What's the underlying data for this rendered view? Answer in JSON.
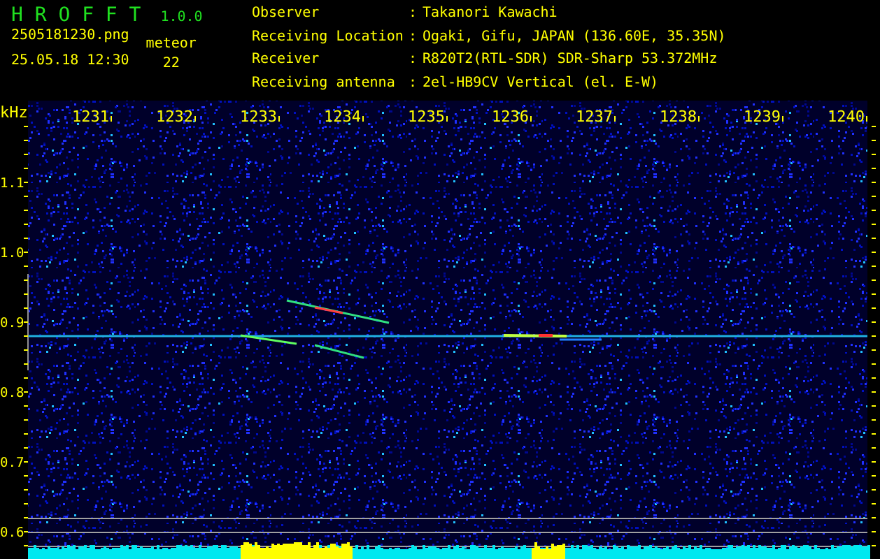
{
  "header": {
    "app_name": "H R O F F T",
    "version": "1.0.0",
    "filename": "2505181230.png",
    "datetime": "25.05.18 12:30",
    "count_label": "meteor",
    "count": "22"
  },
  "info": [
    {
      "label": "Observer",
      "separator": ":",
      "value": "Takanori Kawachi"
    },
    {
      "label": "Receiving Location",
      "separator": ":",
      "value": "Ogaki, Gifu, JAPAN (136.60E, 35.35N)"
    },
    {
      "label": "Receiver",
      "separator": ":",
      "value": "R820T2(RTL-SDR) SDR-Sharp 53.372MHz"
    },
    {
      "label": "Receiving antenna",
      "separator": ":",
      "value": "2el-HB9CV Vertical (el. E-W)"
    }
  ],
  "spectrogram": {
    "y_unit": "kHz",
    "x_ticks": [
      "1231",
      "1232",
      "1233",
      "1234",
      "1235",
      "1236",
      "1237",
      "1238",
      "1239",
      "1240"
    ],
    "y_ticks": [
      "1.1",
      "1.0",
      "0.9",
      "0.8",
      "0.7",
      "0.6"
    ]
  }
}
